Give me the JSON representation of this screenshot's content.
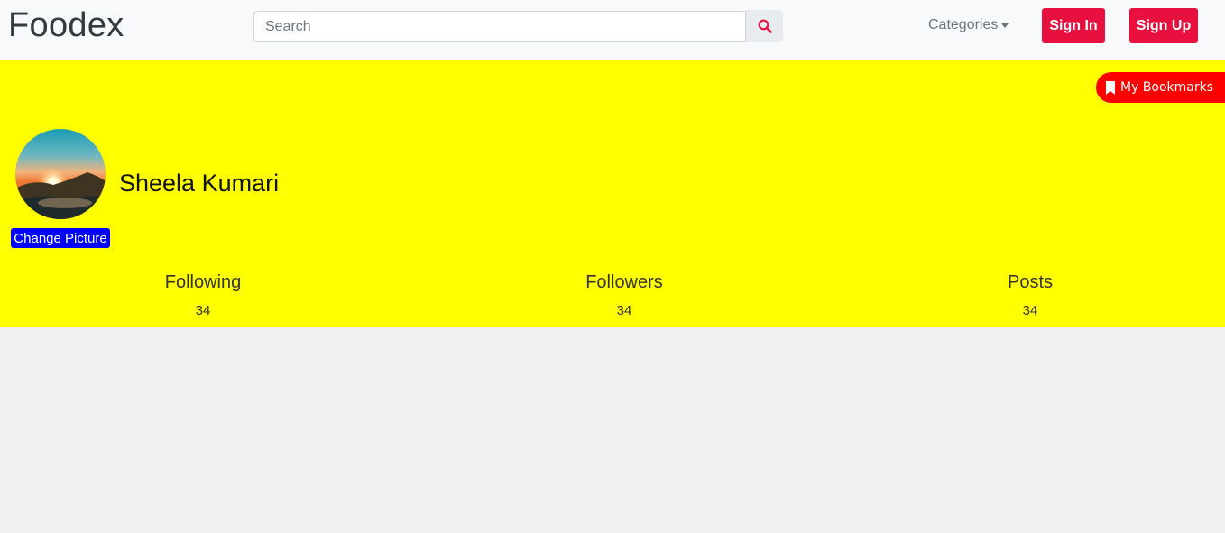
{
  "navbar": {
    "brand": "Foodex",
    "search_placeholder": "Search",
    "search_icon": "search-icon",
    "categories_label": "Categories",
    "signin_label": "Sign In",
    "signup_label": "Sign Up"
  },
  "profile": {
    "bookmarks_label": "My Bookmarks",
    "bookmark_icon": "bookmark-icon",
    "name": "Sheela Kumari",
    "change_picture_label": "Change Picture",
    "stats": [
      {
        "label": "Following",
        "value": "34"
      },
      {
        "label": "Followers",
        "value": "34"
      },
      {
        "label": "Posts",
        "value": "34"
      }
    ]
  },
  "colors": {
    "accent_red": "#e8103e",
    "profile_bg": "#ffff00",
    "bookmark_bg": "#ff0000",
    "change_pic_bg": "#0000ff"
  }
}
